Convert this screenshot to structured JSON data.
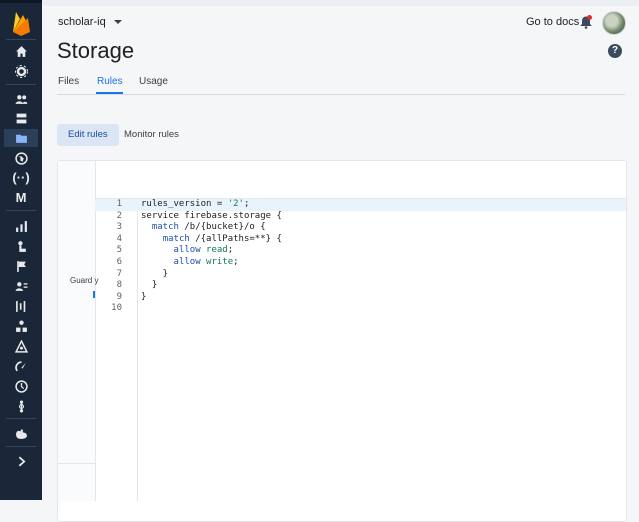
{
  "header": {
    "project_name": "scholar-iq",
    "docs_link": "Go to docs",
    "page_title": "Storage"
  },
  "tabs": [
    {
      "label": "Files"
    },
    {
      "label": "Rules"
    },
    {
      "label": "Usage"
    }
  ],
  "subtabs": [
    {
      "label": "Edit rules"
    },
    {
      "label": "Monitor rules"
    }
  ],
  "sidebar": {
    "items": [
      {
        "icon": "home-icon"
      },
      {
        "icon": "gear-icon"
      },
      {
        "icon": "users-icon"
      },
      {
        "icon": "database-icon"
      },
      {
        "icon": "storage-folder-icon"
      },
      {
        "icon": "hosting-globe-icon"
      },
      {
        "icon": "functions-icon"
      },
      {
        "icon": "ml-icon"
      },
      {
        "icon": "analytics-bar-icon"
      },
      {
        "icon": "predictions-icon"
      },
      {
        "icon": "flag-icon"
      },
      {
        "icon": "audiences-icon"
      },
      {
        "icon": "a-b-testing-icon"
      },
      {
        "icon": "extensions-icon"
      },
      {
        "icon": "distribution-icon"
      },
      {
        "icon": "performance-icon"
      },
      {
        "icon": "clock-icon"
      },
      {
        "icon": "crashlytics-icon"
      },
      {
        "icon": "extensions-hand-icon"
      },
      {
        "icon": "expand-chevron-icon"
      }
    ],
    "active_index": 4
  },
  "editor": {
    "guard_label": "Guard y",
    "lines": [
      "rules_version = '2';",
      "service firebase.storage {",
      "  match /b/{bucket}/o {",
      "    match /{allPaths=**} {",
      "      allow read;",
      "      allow write;",
      "    }",
      "  }",
      "}",
      ""
    ],
    "line_numbers": [
      "1",
      "2",
      "3",
      "4",
      "5",
      "6",
      "7",
      "8",
      "9",
      "10"
    ]
  },
  "colors": {
    "sidebar_bg": "#1a2738",
    "accent": "#1a73e8",
    "brand_flame": "#ffa000"
  }
}
